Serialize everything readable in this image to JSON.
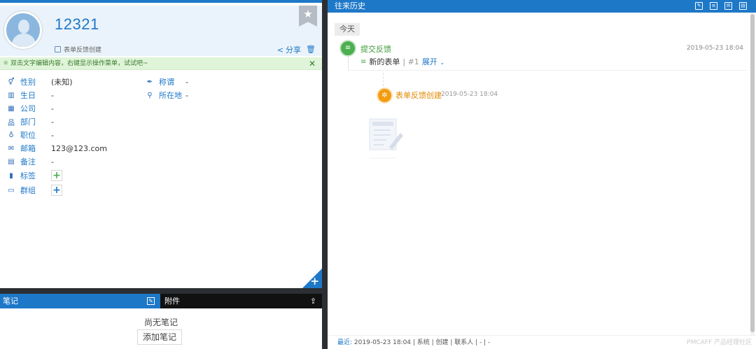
{
  "contact": {
    "name": "12321",
    "source": "表单反馈创建",
    "share_label": "分享"
  },
  "tip": {
    "text": "双击文字编辑内容，右键显示操作菜单，试试吧~"
  },
  "fields": {
    "gender": {
      "label": "性别",
      "value": "(未知)"
    },
    "birthday": {
      "label": "生日",
      "value": "-"
    },
    "company": {
      "label": "公司",
      "value": "-"
    },
    "department": {
      "label": "部门",
      "value": "-"
    },
    "position": {
      "label": "职位",
      "value": "-"
    },
    "email": {
      "label": "邮箱",
      "value": "123@123.com"
    },
    "remark": {
      "label": "备注",
      "value": "-"
    },
    "tags": {
      "label": "标签"
    },
    "groups": {
      "label": "群组"
    },
    "title": {
      "label": "称谓",
      "value": "-"
    },
    "location": {
      "label": "所在地",
      "value": "-"
    }
  },
  "notes": {
    "header": "笔记",
    "empty_text": "尚无笔记",
    "add_label": "添加笔记"
  },
  "attachments": {
    "header": "附件"
  },
  "history": {
    "header": "往来历史",
    "today_label": "今天",
    "event": {
      "title": "提交反馈",
      "time": "2019-05-23 18:04",
      "form_name": "新的表单",
      "form_number": "| #1",
      "expand_label": "展开"
    },
    "sub_event": {
      "title": "表单反馈创建",
      "time": "2019-05-23 18:04"
    },
    "footer": {
      "recent_label": "最近:",
      "recent_text": "2019-05-23 18:04 | 系统 | 创建 | 联系人 | - | -"
    },
    "watermark": "PMCAFF 产品经理社区"
  },
  "colors": {
    "accent": "#1e78c8",
    "tip_bg": "#dff4d9",
    "event_green": "#4caf50",
    "sub_event_orange": "#f39c12"
  }
}
